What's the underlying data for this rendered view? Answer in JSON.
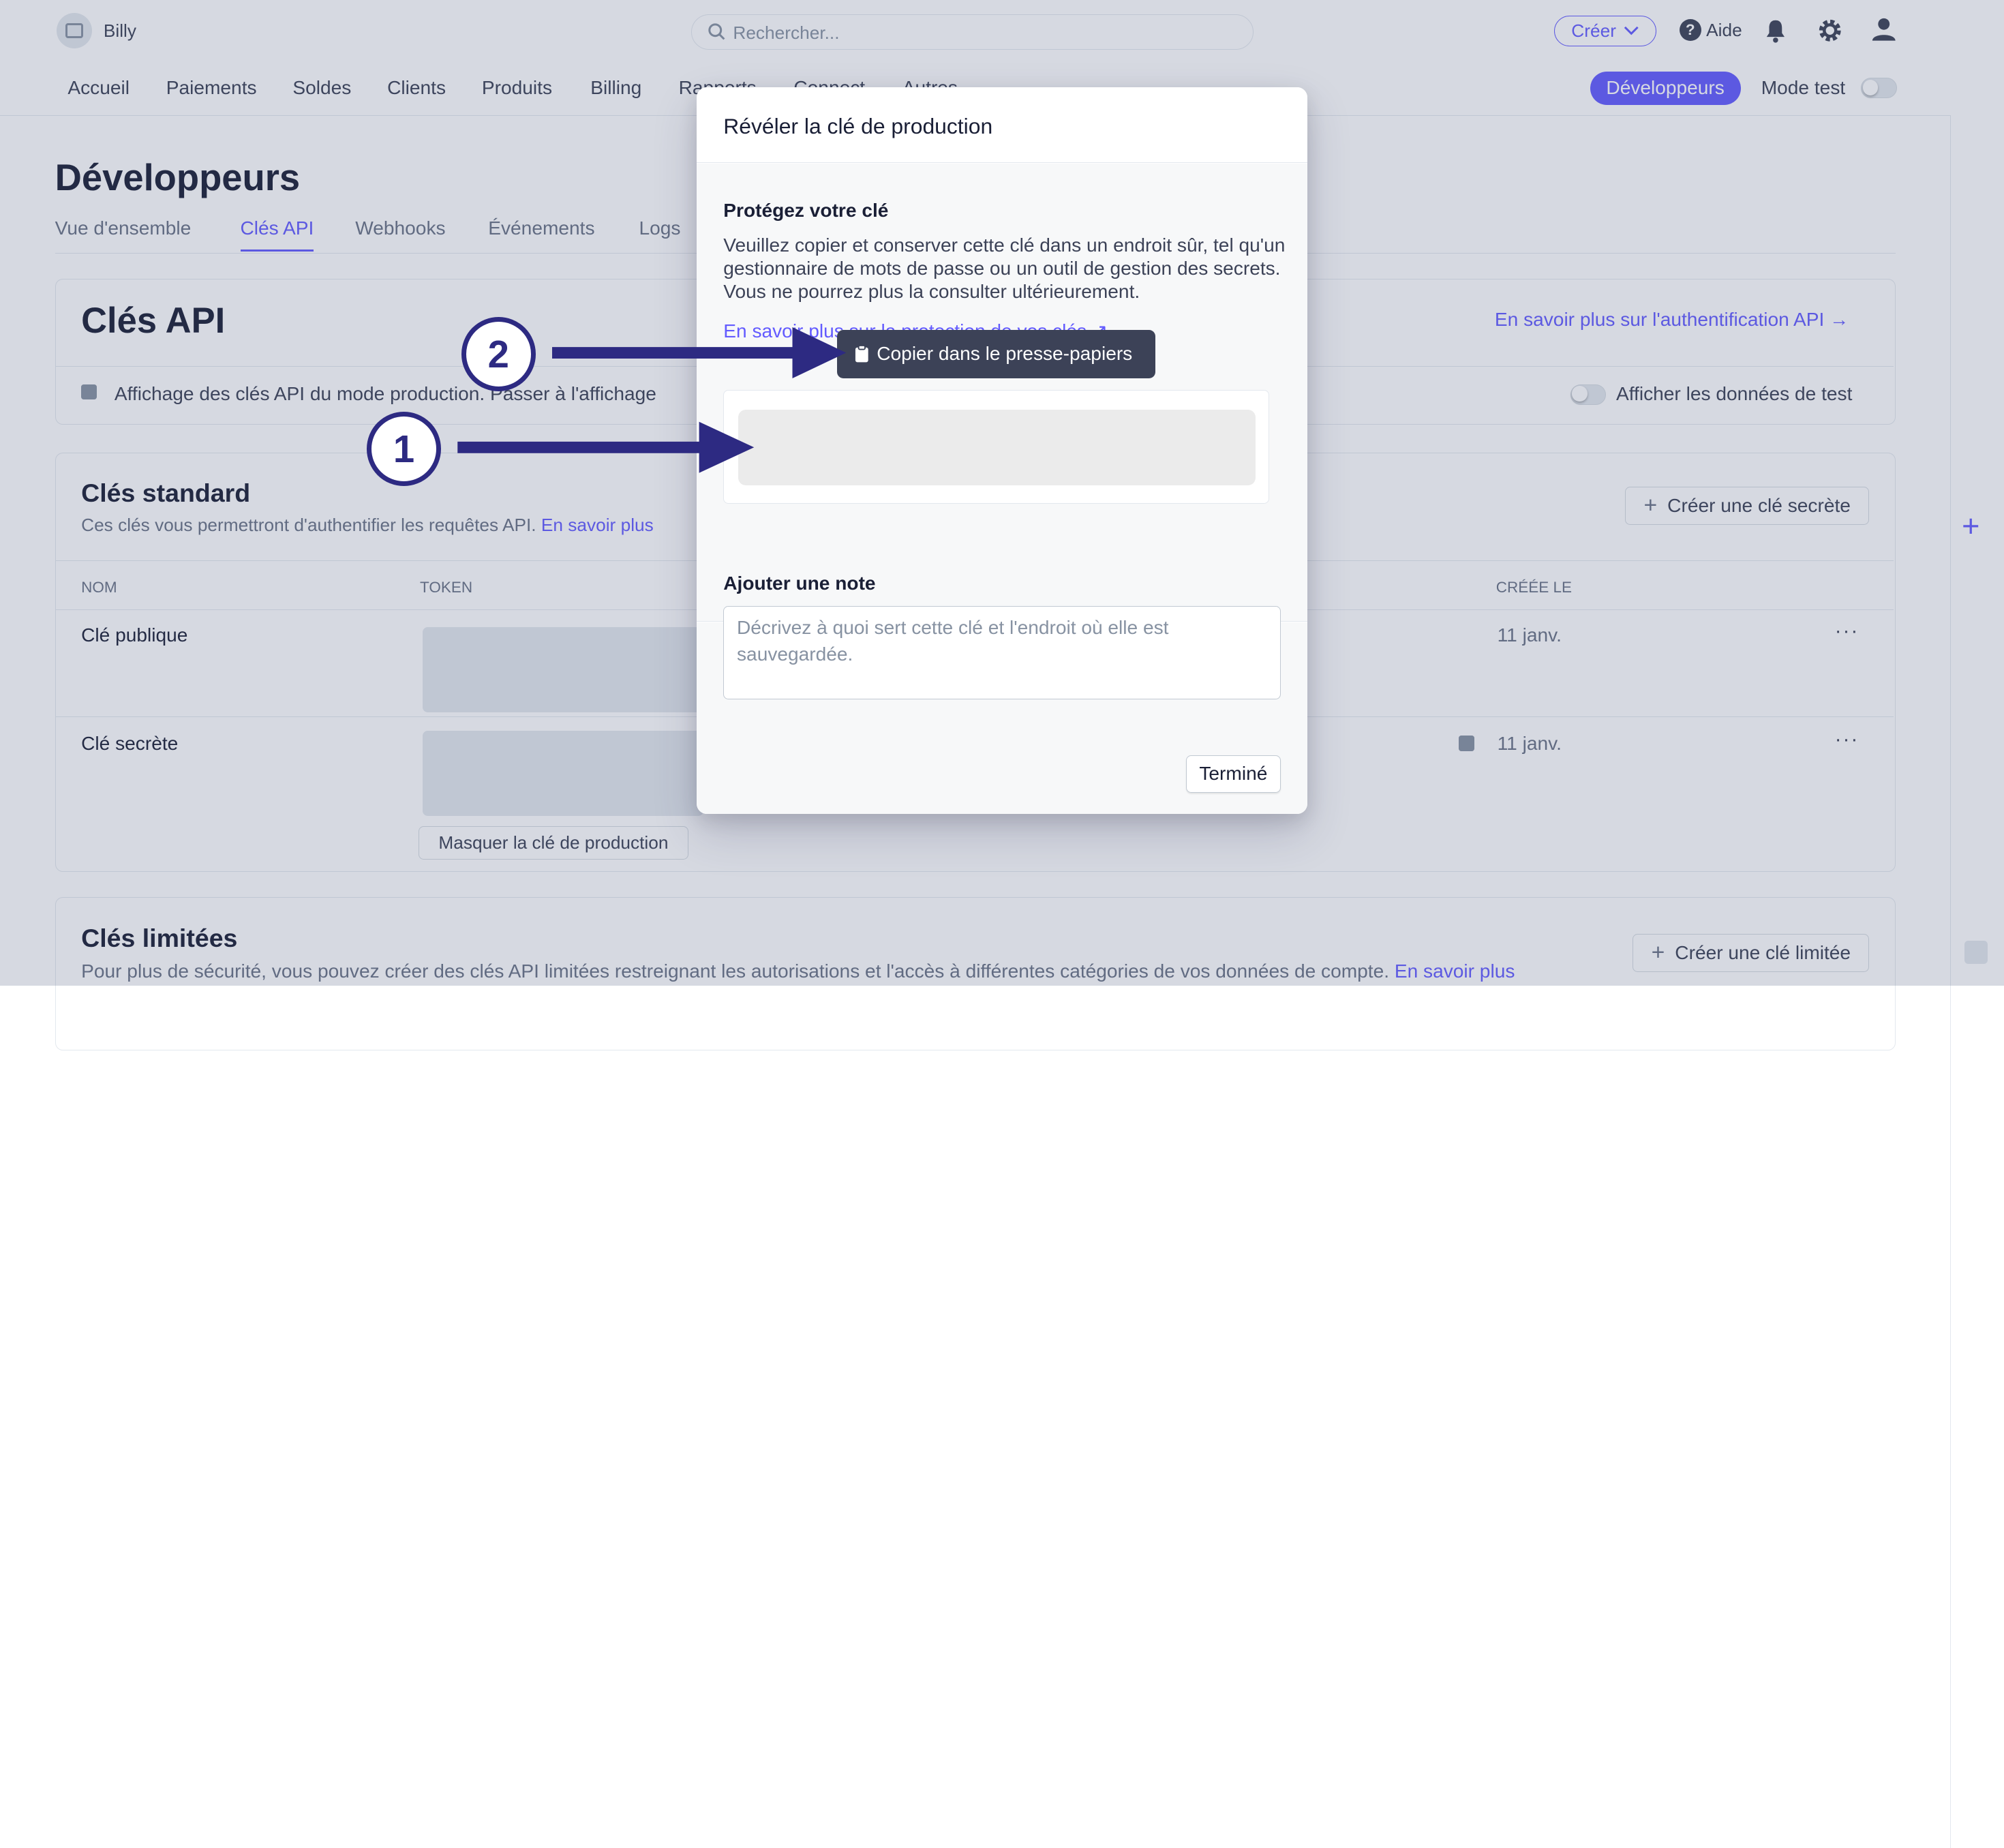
{
  "topbar": {
    "brand_name": "Billy",
    "search_placeholder": "Rechercher...",
    "create_label": "Créer",
    "help_label": "Aide"
  },
  "nav": {
    "items": [
      "Accueil",
      "Paiements",
      "Soldes",
      "Clients",
      "Produits",
      "Billing",
      "Rapports",
      "Connect",
      "Autres"
    ],
    "developers_label": "Développeurs",
    "test_mode_label": "Mode test"
  },
  "page": {
    "title": "Développeurs",
    "tabs": [
      "Vue d'ensemble",
      "Clés API",
      "Webhooks",
      "Événements",
      "Logs"
    ],
    "active_tab": "Clés API",
    "card_title": "Clés API",
    "auth_link": "En savoir plus sur l'authentification API →",
    "info_text": "Affichage des clés API du mode production. Passer à l'affichage",
    "show_test_data": "Afficher les données de test"
  },
  "standard_keys": {
    "title": "Clés standard",
    "description": "Ces clés vous permettront d'authentifier les requêtes API.",
    "learn_more": "En savoir plus",
    "create_secret": "Créer une clé secrète",
    "columns": [
      "NOM",
      "TOKEN",
      "CRÉÉE LE"
    ],
    "rows": [
      {
        "name": "Clé publique",
        "created": "11 janv."
      },
      {
        "name": "Clé secrète",
        "created": "11 janv."
      }
    ],
    "hide_prod_key": "Masquer la clé de production"
  },
  "restricted_keys": {
    "title": "Clés limitées",
    "description": "Pour plus de sécurité, vous pouvez créer des clés API limitées restreignant les autorisations et l'accès à différentes catégories de vos données de compte.",
    "learn_more": "En savoir plus",
    "create_label": "Créer une clé limitée"
  },
  "modal": {
    "title": "Révéler la clé de production",
    "protect_title": "Protégez votre clé",
    "protect_text": "Veuillez copier et conserver cette clé dans un endroit sûr, tel qu'un gestionnaire de mots de passe ou un outil de gestion des secrets. Vous ne pourrez plus la consulter ultérieurement.",
    "protect_link": "En savoir plus sur la protection de vos clés ↗",
    "note_title": "Ajouter une note",
    "note_placeholder": "Décrivez à quoi sert cette clé et l'endroit où elle est sauvegardée.",
    "done_label": "Terminé"
  },
  "tooltip": {
    "label": "Copier dans le presse-papiers"
  },
  "annotations": {
    "marker1": "1",
    "marker2": "2"
  },
  "colors": {
    "accent": "#635bff",
    "annotation": "#2d2a82"
  }
}
